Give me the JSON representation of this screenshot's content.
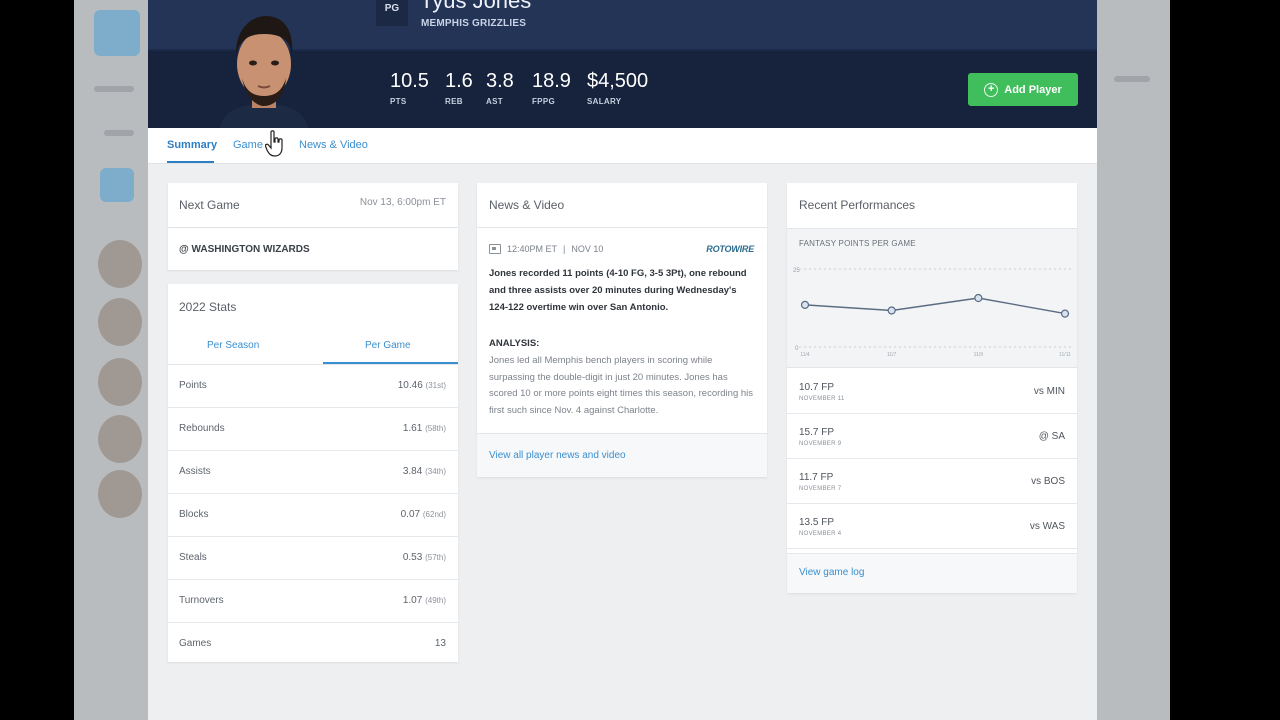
{
  "player": {
    "position": "PG",
    "name": "Tyus Jones",
    "team": "MEMPHIS GRIZZLIES"
  },
  "summary_stats": [
    {
      "value": "10.5",
      "label": "PTS"
    },
    {
      "value": "1.6",
      "label": "REB"
    },
    {
      "value": "3.8",
      "label": "AST"
    },
    {
      "value": "18.9",
      "label": "FPPG"
    },
    {
      "value": "$4,500",
      "label": "SALARY"
    }
  ],
  "add_button": {
    "label": "Add Player",
    "icon": "plus-circle-icon"
  },
  "tabs": [
    {
      "label": "Summary",
      "active": true
    },
    {
      "label": "Game"
    },
    {
      "label": "News & Video"
    }
  ],
  "next_game": {
    "title": "Next Game",
    "date": "Nov 13, 6:00pm ET",
    "opponent": "@ WASHINGTON WIZARDS"
  },
  "stats_card": {
    "title": "2022 Stats",
    "tabs": [
      "Per Season",
      "Per Game"
    ],
    "active_tab": "Per Game",
    "rows": [
      {
        "name": "Points",
        "value": "10.46",
        "rank": "(31st)"
      },
      {
        "name": "Rebounds",
        "value": "1.61",
        "rank": "(58th)"
      },
      {
        "name": "Assists",
        "value": "3.84",
        "rank": "(34th)"
      },
      {
        "name": "Blocks",
        "value": "0.07",
        "rank": "(62nd)"
      },
      {
        "name": "Steals",
        "value": "0.53",
        "rank": "(57th)"
      },
      {
        "name": "Turnovers",
        "value": "1.07",
        "rank": "(49th)"
      },
      {
        "name": "Games",
        "value": "13",
        "rank": ""
      }
    ]
  },
  "news": {
    "title": "News & Video",
    "time": "12:40PM ET",
    "date": "NOV 10",
    "source": "ROTOWIRE",
    "headline": "Jones recorded 11 points (4-10 FG, 3-5 3Pt), one rebound and three assists over 20 minutes during Wednesday's 124-122 overtime win over San Antonio.",
    "analysis_label": "ANALYSIS:",
    "analysis": "Jones led all Memphis bench players in scoring while surpassing the double-digit in just 20 minutes. Jones has scored 10 or more points eight times this season, recording his first such since Nov. 4 against Charlotte.",
    "footer_link": "View all player news and video"
  },
  "recent": {
    "title": "Recent Performances",
    "chart_title": "FANTASY POINTS PER GAME",
    "chart_data": {
      "type": "line",
      "x": [
        "11/4",
        "11/7",
        "11/9",
        "11/11"
      ],
      "values": [
        13.5,
        11.7,
        15.7,
        10.7
      ],
      "ylim": [
        0,
        25
      ],
      "y_tick_labels": [
        "25",
        "0"
      ],
      "grid": true
    },
    "games": [
      {
        "fp": "10.7 FP",
        "date": "NOVEMBER 11",
        "opponent": "vs MIN"
      },
      {
        "fp": "15.7 FP",
        "date": "NOVEMBER 9",
        "opponent": "@ SA"
      },
      {
        "fp": "11.7 FP",
        "date": "NOVEMBER 7",
        "opponent": "vs BOS"
      },
      {
        "fp": "13.5 FP",
        "date": "NOVEMBER 4",
        "opponent": "vs WAS"
      }
    ],
    "footer_link": "View game log"
  },
  "colors": {
    "header_dark": "#17233d",
    "header_top": "#233457",
    "accent_blue": "#2d7fc4",
    "add_green": "#3fbe5b"
  }
}
